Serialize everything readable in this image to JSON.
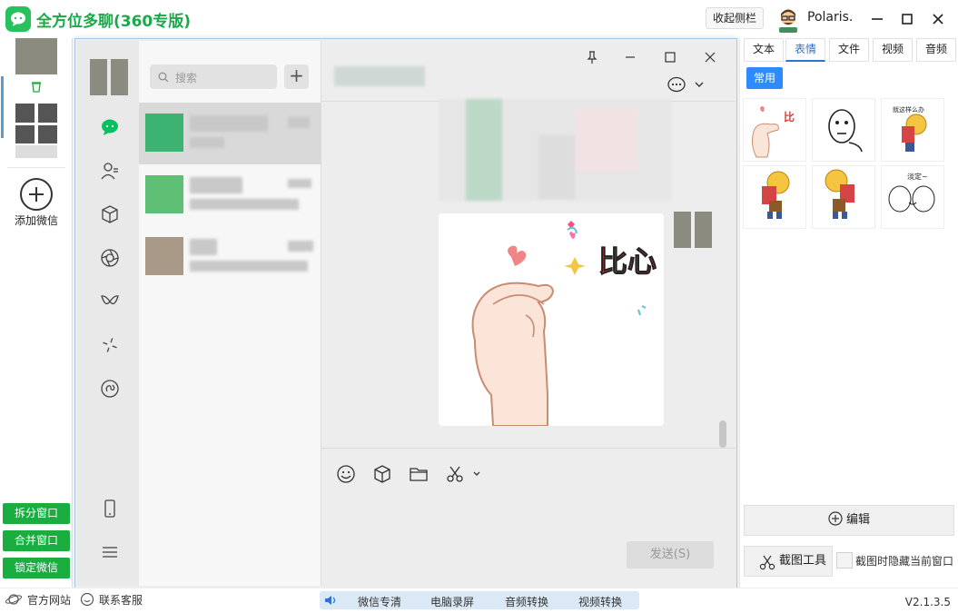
{
  "app": {
    "title": "全方位多聊(360专版)",
    "collapse_sidebar": "收起侧栏",
    "user_name": "Polaris."
  },
  "left_sidebar": {
    "add_wechat": "添加微信",
    "buttons": [
      "拆分窗口",
      "合并窗口",
      "锁定微信"
    ]
  },
  "footer": {
    "official_site": "官方网站",
    "support": "联系客服",
    "tools": [
      "微信专清",
      "电脑录屏",
      "音频转换",
      "视频转换"
    ],
    "version": "V2.1.3.5"
  },
  "wechat": {
    "search_placeholder": "搜索",
    "add_symbol": "+",
    "send_label": "发送(S)",
    "sticker_text": "比心"
  },
  "right_panel": {
    "tabs": [
      "文本",
      "表情",
      "文件",
      "视频",
      "音频"
    ],
    "active_tab": "表情",
    "category": "常用",
    "sticker_captions": [
      "比",
      "",
      "就这样么办",
      "",
      "",
      "淡定~"
    ],
    "edit_label": "编辑",
    "screenshot_tool": "截图工具",
    "hide_when_capture": "截图时隐藏当前窗口"
  },
  "colors": {
    "brand_green": "#1aad3f",
    "accent_blue": "#2e8bff",
    "link_blue": "#2e72d2"
  }
}
